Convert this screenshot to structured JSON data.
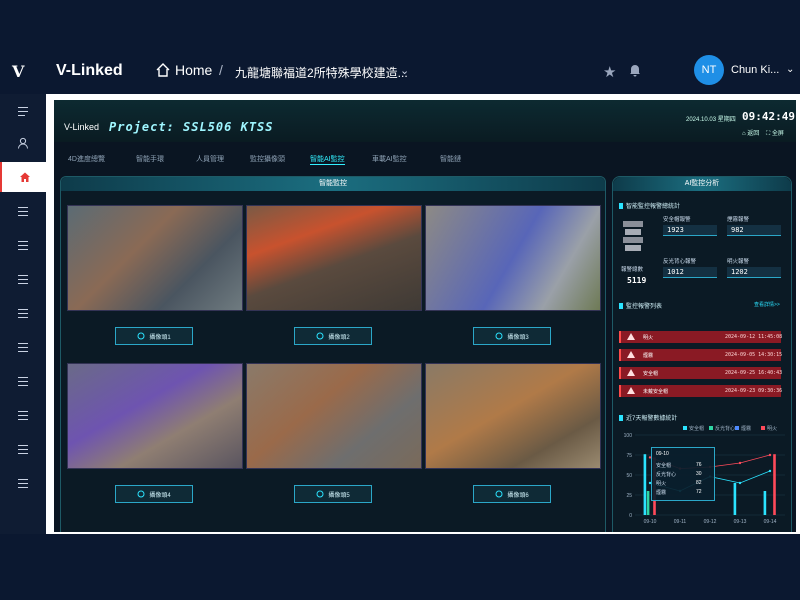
{
  "app": {
    "brand": "V-Linked",
    "logo_mark": "V"
  },
  "nav": {
    "home": "Home",
    "breadcrumb": "九龍塘聯福道2所特殊學校建造..."
  },
  "user": {
    "initials": "NT",
    "name": "Chun Ki..."
  },
  "colors": {
    "accent": "#1f8fe6",
    "active_sidebar": "#e53935",
    "cyan": "#32f0ff"
  },
  "sidebar": {
    "icons": [
      "menu-icon",
      "user-icon",
      "home-icon",
      "list-icon",
      "list-icon",
      "list-icon",
      "list-icon",
      "list-icon",
      "list-icon",
      "list-icon",
      "list-icon",
      "list-icon"
    ],
    "active_index": 2
  },
  "dashboard": {
    "logo": "V-Linked",
    "project": "Project: SSL506 KTSS",
    "date": "2024.10.03",
    "weekday": "星期四",
    "time": "09:42:49",
    "icon_labels": [
      "返回",
      "全屏"
    ],
    "tabs": [
      "4D進度總覽",
      "智能手環",
      "人員管理",
      "監控攝像頭",
      "智能AI監控",
      "車載AI監控",
      "智能鏈"
    ],
    "active_tab": 4,
    "monitor_title": "智能監控",
    "cameras": [
      "攝像頭1",
      "攝像頭2",
      "攝像頭3",
      "攝像頭4",
      "攝像頭5",
      "攝像頭6"
    ],
    "ai_title": "AI監控分析",
    "stats_title": "智能監控報警總統計",
    "total_label": "報警總數",
    "total": "5119",
    "stats": [
      {
        "label": "安全帽報警",
        "value": "1923"
      },
      {
        "label": "煙霧報警",
        "value": "982"
      },
      {
        "label": "反光背心報警",
        "value": "1012"
      },
      {
        "label": "明火報警",
        "value": "1202"
      }
    ],
    "alarm_list_title": "監控報警列表",
    "more_label": "查看詳情>>",
    "alarms": [
      {
        "type": "明火",
        "time": "2024-09-12 11:45:08"
      },
      {
        "type": "煙霧",
        "time": "2024-09-05 14:30:15"
      },
      {
        "type": "安全帽",
        "time": "2024-09-25 16:40:43"
      },
      {
        "type": "未戴安全帽",
        "time": "2024-09-23 09:30:36"
      }
    ],
    "chart_title": "近7天報警數據統計"
  },
  "chart_data": {
    "type": "bar",
    "title": "近7天報警數據統計",
    "categories": [
      "09-10",
      "09-11",
      "09-12",
      "09-13",
      "09-14"
    ],
    "series": [
      {
        "name": "安全帽",
        "values": [
          76,
          0,
          0,
          40,
          30
        ]
      },
      {
        "name": "反光背心",
        "values": [
          30,
          0,
          0,
          0,
          0
        ]
      },
      {
        "name": "煙霧",
        "values": [
          0,
          0,
          0,
          0,
          0
        ]
      },
      {
        "name": "明火",
        "values": [
          72,
          0,
          0,
          0,
          76
        ]
      }
    ],
    "line_series": [
      {
        "name": "明火",
        "values": [
          72,
          58,
          60,
          65,
          75
        ]
      },
      {
        "name": "安全帽",
        "values": [
          40,
          30,
          48,
          40,
          55
        ]
      }
    ],
    "ylim": [
      0,
      100
    ],
    "yticks": [
      0,
      25,
      50,
      75,
      100
    ],
    "tooltip": {
      "date": "09-10",
      "rows": [
        {
          "label": "安全帽",
          "value": "76"
        },
        {
          "label": "反光背心",
          "value": "30"
        },
        {
          "label": "明火",
          "value": "82"
        },
        {
          "label": "煙霧",
          "value": "72"
        }
      ]
    },
    "colors": {
      "安全帽": "#2be3ff",
      "反光背心": "#2fd6a4",
      "煙霧": "#4f8bff",
      "明火": "#ff4a5a"
    }
  }
}
